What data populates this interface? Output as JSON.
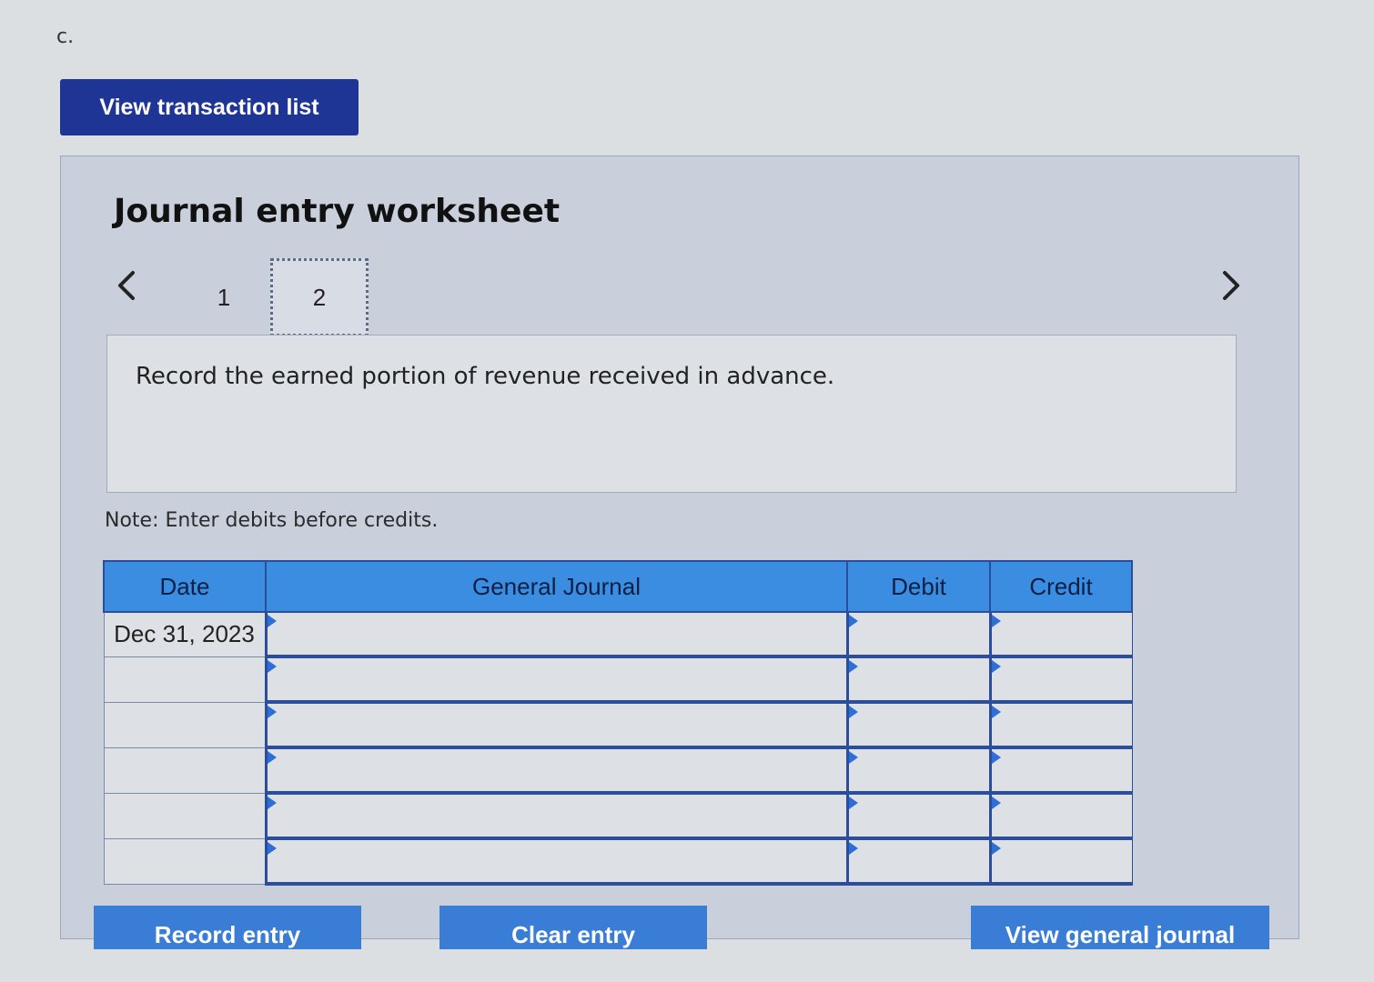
{
  "part_label": "c.",
  "view_transactions_label": "View transaction list",
  "worksheet": {
    "title": "Journal entry worksheet",
    "steps": [
      "1",
      "2"
    ],
    "active_step": "2",
    "instruction": "Record the earned portion of revenue received in advance.",
    "note": "Note: Enter debits before credits."
  },
  "table": {
    "headers": {
      "date": "Date",
      "account": "General Journal",
      "debit": "Debit",
      "credit": "Credit"
    },
    "rows": [
      {
        "date": "Dec 31, 2023",
        "account": "",
        "debit": "",
        "credit": ""
      },
      {
        "date": "",
        "account": "",
        "debit": "",
        "credit": ""
      },
      {
        "date": "",
        "account": "",
        "debit": "",
        "credit": ""
      },
      {
        "date": "",
        "account": "",
        "debit": "",
        "credit": ""
      },
      {
        "date": "",
        "account": "",
        "debit": "",
        "credit": ""
      },
      {
        "date": "",
        "account": "",
        "debit": "",
        "credit": ""
      }
    ]
  },
  "buttons": {
    "record": "Record entry",
    "clear": "Clear entry",
    "view_journal": "View general journal"
  },
  "icons": {
    "prev": "chevron-left-icon",
    "next": "chevron-right-icon"
  },
  "colors": {
    "dark_button": "#1f3596",
    "header_blue": "#3a8de0",
    "action_blue": "#3a7dd6"
  }
}
